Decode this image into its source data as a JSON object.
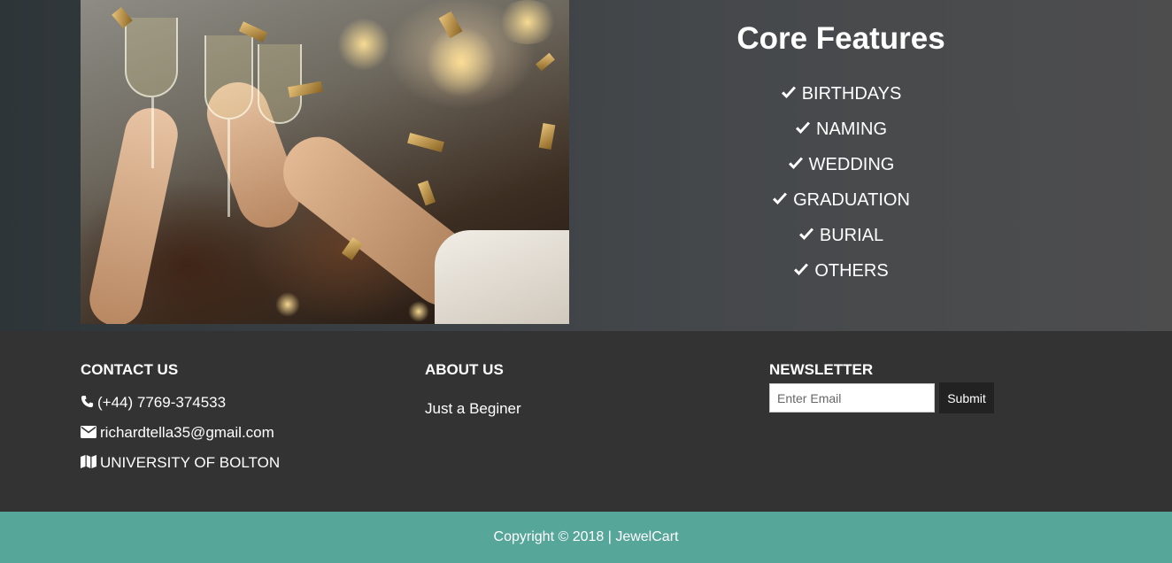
{
  "features": {
    "title": "Core Features",
    "items": [
      {
        "label": "BIRTHDAYS",
        "icon": "check-icon"
      },
      {
        "label": "NAMING",
        "icon": "check-icon"
      },
      {
        "label": "WEDDING",
        "icon": "check-icon"
      },
      {
        "label": "GRADUATION",
        "icon": "check-icon"
      },
      {
        "label": "BURIAL",
        "icon": "check-icon"
      },
      {
        "label": "OTHERS",
        "icon": "check-icon"
      }
    ]
  },
  "footer": {
    "contact": {
      "heading": "CONTACT US",
      "phone": "(+44) 7769-374533",
      "email": "richardtella35@gmail.com",
      "address": "UNIVERSITY OF BOLTON"
    },
    "about": {
      "heading": "ABOUT US",
      "text": "Just a Beginer"
    },
    "newsletter": {
      "heading": "NEWSLETTER",
      "placeholder": "Enter Email",
      "submit_label": "Submit"
    }
  },
  "copyright": "Copyright © 2018 | JewelCart",
  "colors": {
    "footer_bg": "#333333",
    "copyright_bg": "#56a69a",
    "text": "#ffffff"
  }
}
